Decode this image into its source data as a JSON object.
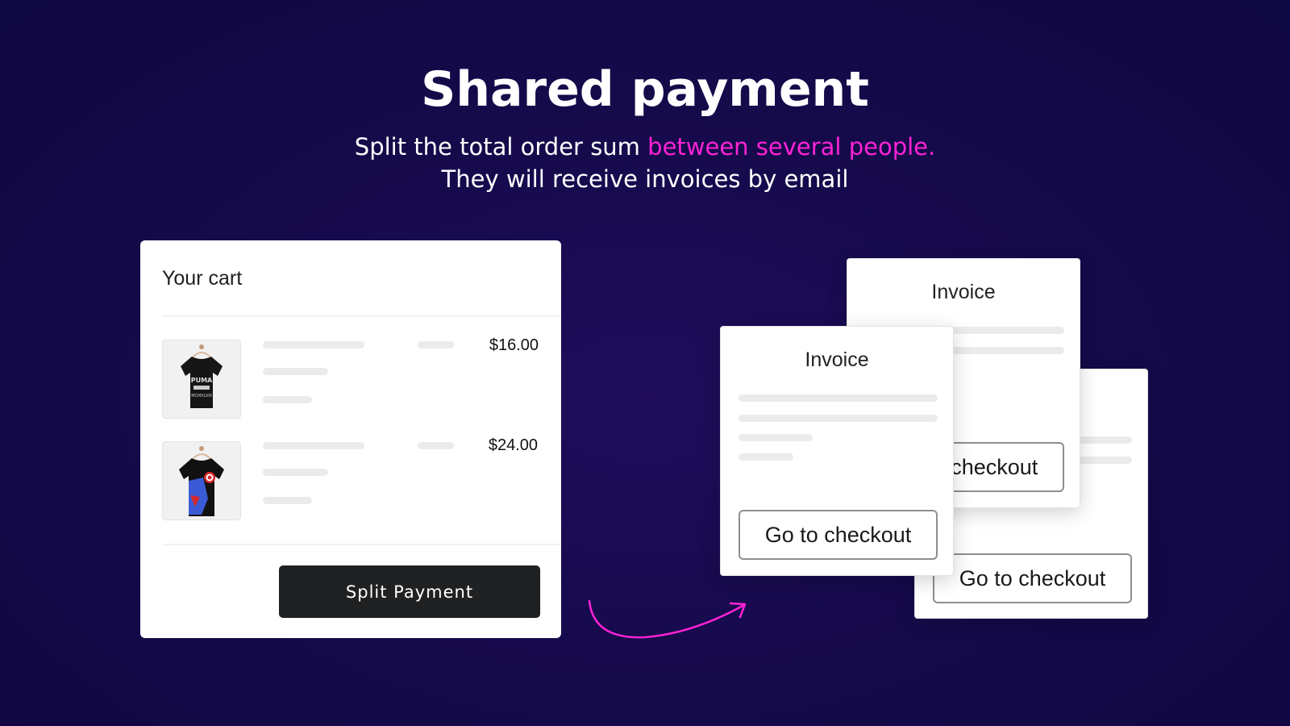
{
  "hero": {
    "title": "Shared payment",
    "subtitle_start": "Split the total order sum ",
    "subtitle_accent": "between several people.",
    "subtitle_line2": "They will receive invoices by email"
  },
  "colors": {
    "background": "#130a45",
    "accent": "#ff22d6",
    "button": "#202122"
  },
  "cart": {
    "title": "Your cart",
    "items": [
      {
        "image": "puma-black-tshirt",
        "price": "$16.00"
      },
      {
        "image": "avengers-black-tshirt",
        "price": "$24.00"
      }
    ],
    "split_button": "Split Payment"
  },
  "invoices": [
    {
      "title": "Invoice",
      "button": "Go to checkout"
    },
    {
      "title": "Invoice",
      "button": "Go to checkout"
    },
    {
      "title": "Invoice",
      "button": "Go to checkout"
    }
  ]
}
